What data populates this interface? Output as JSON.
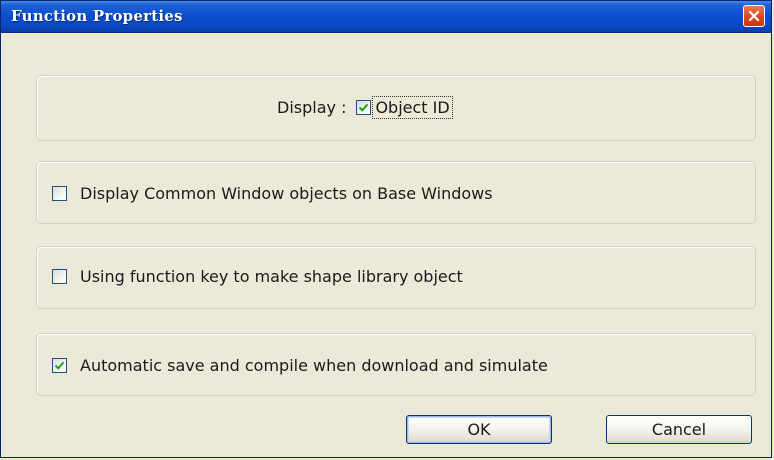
{
  "window": {
    "title": "Function Properties"
  },
  "display_group": {
    "label": "Display :",
    "object_id": {
      "label": "Object ID",
      "checked": true
    }
  },
  "options": [
    {
      "label": "Display Common Window objects on Base Windows",
      "checked": false
    },
    {
      "label": "Using function key to make shape library object",
      "checked": false
    },
    {
      "label": "Automatic save and compile when download and simulate",
      "checked": true
    }
  ],
  "buttons": {
    "ok_label": "OK",
    "cancel_label": "Cancel"
  },
  "icons": {
    "close": "close-icon",
    "check": "checkmark-icon"
  },
  "colors": {
    "titlebar": "#0a4fcf",
    "close_button": "#d9461f",
    "checkmark": "#21a121",
    "dialog_background": "#ece9d8"
  }
}
